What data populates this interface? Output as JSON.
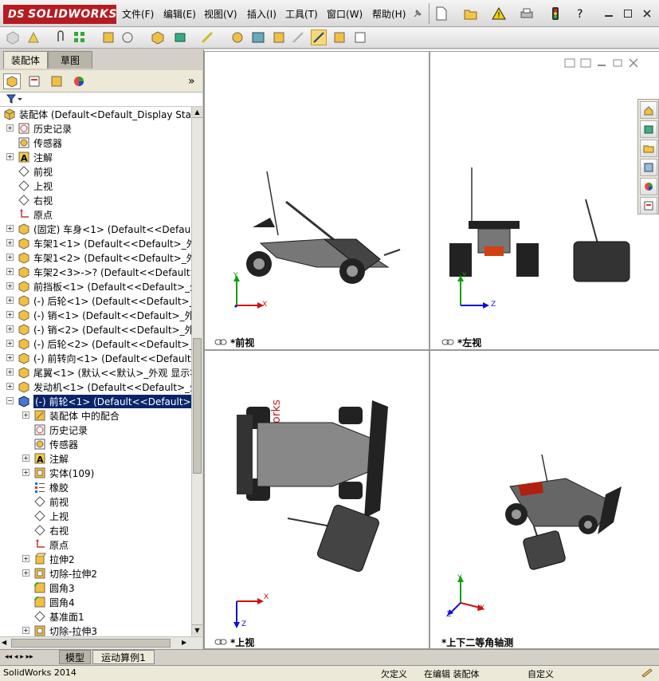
{
  "app": {
    "logo_prefix": "DS",
    "logo_text": "SOLIDWORKS"
  },
  "menu": [
    "文件(F)",
    "编辑(E)",
    "视图(V)",
    "插入(I)",
    "工具(T)",
    "窗口(W)",
    "帮助(H)"
  ],
  "left_tabs": {
    "assembly": "装配体",
    "sketch": "草图"
  },
  "tree": [
    {
      "label": "装配体  (Default<Default_Display Sta",
      "icon": "assembly-icon",
      "level": 0,
      "exp": "none"
    },
    {
      "label": "历史记录",
      "icon": "history-icon",
      "level": 1,
      "exp": "plus"
    },
    {
      "label": "传感器",
      "icon": "sensor-icon",
      "level": 1,
      "exp": "none"
    },
    {
      "label": "注解",
      "icon": "annotation-icon",
      "level": 1,
      "exp": "plus"
    },
    {
      "label": "前视",
      "icon": "plane-icon",
      "level": 1,
      "exp": "none"
    },
    {
      "label": "上视",
      "icon": "plane-icon",
      "level": 1,
      "exp": "none"
    },
    {
      "label": "右视",
      "icon": "plane-icon",
      "level": 1,
      "exp": "none"
    },
    {
      "label": "原点",
      "icon": "origin-icon",
      "level": 1,
      "exp": "none"
    },
    {
      "label": "(固定) 车身<1> (Default<<Default>",
      "icon": "part-icon",
      "level": 1,
      "exp": "plus"
    },
    {
      "label": "车架1<1> (Default<<Default>_外观",
      "icon": "part-icon",
      "level": 1,
      "exp": "plus"
    },
    {
      "label": "车架1<2> (Default<<Default>_外观",
      "icon": "part-icon",
      "level": 1,
      "exp": "plus"
    },
    {
      "label": "车架2<3>->? (Default<<Default>_外",
      "icon": "part-icon",
      "level": 1,
      "exp": "plus"
    },
    {
      "label": "前挡板<1> (Default<<Default>_外观",
      "icon": "part-icon",
      "level": 1,
      "exp": "plus"
    },
    {
      "label": "(-) 后轮<1> (Default<<Default>_外",
      "icon": "part-icon",
      "level": 1,
      "exp": "plus"
    },
    {
      "label": "(-) 销<1> (Default<<Default>_外观",
      "icon": "part-icon",
      "level": 1,
      "exp": "plus"
    },
    {
      "label": "(-) 销<2> (Default<<Default>_外观",
      "icon": "part-icon",
      "level": 1,
      "exp": "plus"
    },
    {
      "label": "(-) 后轮<2> (Default<<Default>_外",
      "icon": "part-icon",
      "level": 1,
      "exp": "plus"
    },
    {
      "label": "(-) 前转向<1> (Default<<Default>_",
      "icon": "part-icon",
      "level": 1,
      "exp": "plus"
    },
    {
      "label": "尾翼<1> (默认<<默认>_外观 显示状",
      "icon": "part-icon",
      "level": 1,
      "exp": "plus"
    },
    {
      "label": "发动机<1> (Default<<Default>_外观",
      "icon": "part-icon",
      "level": 1,
      "exp": "plus"
    },
    {
      "label": "(-) 前轮<1> (Default<<Default> 外",
      "icon": "part-blue-icon",
      "level": 1,
      "exp": "minus",
      "selected": true
    },
    {
      "label": "装配体 中的配合",
      "icon": "mate-icon",
      "level": 2,
      "exp": "plus"
    },
    {
      "label": "历史记录",
      "icon": "history-icon",
      "level": 2,
      "exp": "none"
    },
    {
      "label": "传感器",
      "icon": "sensor-icon",
      "level": 2,
      "exp": "none"
    },
    {
      "label": "注解",
      "icon": "annotation-icon",
      "level": 2,
      "exp": "plus"
    },
    {
      "label": "实体(109)",
      "icon": "solid-body-icon",
      "level": 2,
      "exp": "plus"
    },
    {
      "label": "橡胶",
      "icon": "material-icon",
      "level": 2,
      "exp": "none"
    },
    {
      "label": "前视",
      "icon": "plane-icon",
      "level": 2,
      "exp": "none"
    },
    {
      "label": "上视",
      "icon": "plane-icon",
      "level": 2,
      "exp": "none"
    },
    {
      "label": "右视",
      "icon": "plane-icon",
      "level": 2,
      "exp": "none"
    },
    {
      "label": "原点",
      "icon": "origin-icon",
      "level": 2,
      "exp": "none"
    },
    {
      "label": "拉伸2",
      "icon": "extrude-icon",
      "level": 2,
      "exp": "plus"
    },
    {
      "label": "切除-拉伸2",
      "icon": "cut-extrude-icon",
      "level": 2,
      "exp": "plus"
    },
    {
      "label": "圆角3",
      "icon": "fillet-icon",
      "level": 2,
      "exp": "none"
    },
    {
      "label": "圆角4",
      "icon": "fillet-icon",
      "level": 2,
      "exp": "none"
    },
    {
      "label": "基准面1",
      "icon": "plane-icon",
      "level": 2,
      "exp": "none"
    },
    {
      "label": "切除-拉伸3",
      "icon": "cut-extrude-icon",
      "level": 2,
      "exp": "plus"
    }
  ],
  "bottom_tabs": {
    "model": "模型",
    "motion": "运动算例1"
  },
  "status": {
    "app": "SolidWorks 2014",
    "undefined": "欠定义",
    "editing": "在编辑 装配体",
    "custom": "自定义"
  },
  "views": {
    "front": "*前视",
    "left": "*左视",
    "top": "*上视",
    "iso": "*上下二等角轴测"
  },
  "axes": {
    "x": "X",
    "y": "Y",
    "z": "Z"
  },
  "colors": {
    "selection": "#0a246a",
    "logo": "#b51c22",
    "x_axis": "#d01010",
    "y_axis": "#10a010",
    "z_axis": "#1010d0"
  }
}
